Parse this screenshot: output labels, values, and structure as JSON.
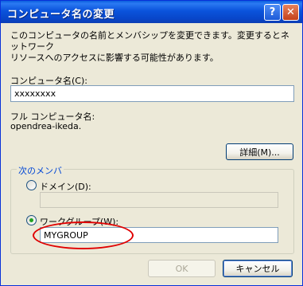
{
  "window": {
    "title": "コンピュータ名の変更"
  },
  "description": "このコンピュータの名前とメンバシップを変更できます。変更するとネットワーク\nリソースへのアクセスに影響する可能性があります。",
  "computer_name": {
    "label": "コンピュータ名(C):",
    "value": "xxxxxxxx"
  },
  "full_name": {
    "label": "フル コンピュータ名:",
    "value": "opendrea-ikeda."
  },
  "details_button": "詳細(M)...",
  "membership": {
    "title": "次のメンバ",
    "domain": {
      "label": "ドメイン(D):",
      "selected": false,
      "value": ""
    },
    "workgroup": {
      "label": "ワークグループ(W):",
      "selected": true,
      "value": "MYGROUP"
    }
  },
  "buttons": {
    "ok": "OK",
    "cancel": "キャンセル"
  },
  "colors": {
    "titlebar": "#0a53dc",
    "group_title": "#0046d5",
    "highlight_ellipse": "#e00000",
    "radio_dot": "#21a121"
  },
  "icons": {
    "help": "help-icon",
    "close": "close-icon"
  }
}
